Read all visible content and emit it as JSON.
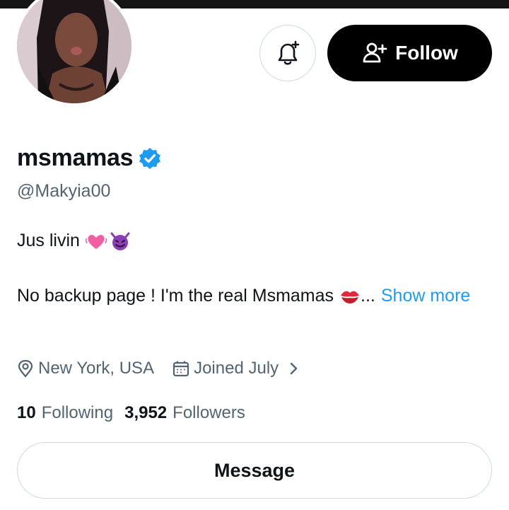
{
  "profile": {
    "display_name": "msmamas",
    "handle": "@Makyia00",
    "verified": true,
    "bio_line1": "Jus livin",
    "bio_line1_emojis": [
      "heart-pulse-emoji",
      "smiling-imp-emoji"
    ],
    "bio_line2": "No backup page ! I'm the real Msmamas",
    "bio_line2_emoji": "kiss-mark-emoji",
    "ellipsis": "...",
    "show_more": "Show more",
    "location": "New York, USA",
    "joined": "Joined July",
    "following_count": "10",
    "following_label": "Following",
    "followers_count": "3,952",
    "followers_label": "Followers"
  },
  "actions": {
    "follow_label": "Follow",
    "message_label": "Message",
    "notify_icon": "bell-plus-icon",
    "follow_icon": "person-plus-icon"
  },
  "colors": {
    "accent": "#1d9bf0",
    "text": "#0f1419",
    "muted": "#536471",
    "border": "#cfd9de",
    "follow_bg": "#000000"
  }
}
